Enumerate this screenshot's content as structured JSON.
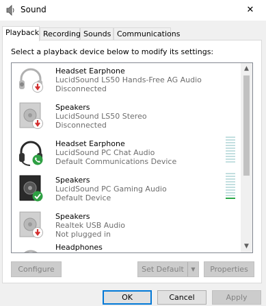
{
  "window": {
    "title": "Sound",
    "close_glyph": "✕"
  },
  "tabs": [
    {
      "label": "Playback",
      "active": true
    },
    {
      "label": "Recording",
      "active": false
    },
    {
      "label": "Sounds",
      "active": false
    },
    {
      "label": "Communications",
      "active": false
    }
  ],
  "instruction": "Select a playback device below to modify its settings:",
  "devices": [
    {
      "name": "Headset Earphone",
      "description": "LucidSound LS50 Hands-Free AG Audio",
      "status": "Disconnected",
      "icon": "headset-icon",
      "badge": "red-down-arrow",
      "level": null
    },
    {
      "name": "Speakers",
      "description": "LucidSound LS50 Stereo",
      "status": "Disconnected",
      "icon": "speaker-icon",
      "badge": "red-down-arrow",
      "level": null
    },
    {
      "name": "Headset Earphone",
      "description": "LucidSound PC Chat Audio",
      "status": "Default Communications Device",
      "icon": "headset-icon",
      "badge": "green-phone",
      "level": 0
    },
    {
      "name": "Speakers",
      "description": "LucidSound PC Gaming Audio",
      "status": "Default Device",
      "icon": "speaker-icon",
      "badge": "green-check",
      "level": 0.1
    },
    {
      "name": "Speakers",
      "description": "Realtek USB Audio",
      "status": "Not plugged in",
      "icon": "speaker-icon",
      "badge": "red-down-arrow",
      "level": null
    },
    {
      "name": "Headphones",
      "description": "",
      "status": "",
      "icon": "headphones-icon",
      "badge": "",
      "level": null
    }
  ],
  "buttons": {
    "configure": "Configure",
    "set_default": "Set Default",
    "properties": "Properties",
    "ok": "OK",
    "cancel": "Cancel",
    "apply": "Apply"
  },
  "colors": {
    "accent": "#0078d7",
    "meter_on": "#29a846",
    "meter_off": "#c3dfe0",
    "badge_red": "#d32f2f",
    "badge_green": "#2ea043"
  }
}
